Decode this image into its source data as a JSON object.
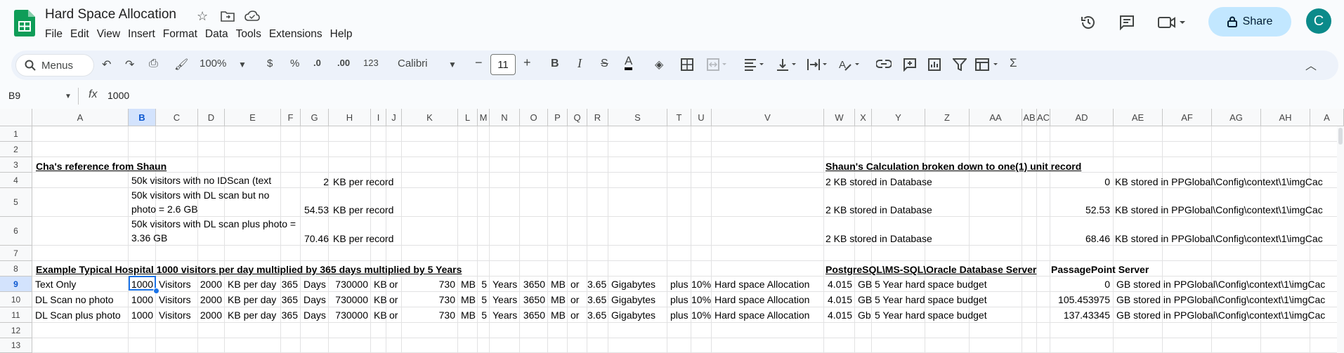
{
  "app": {
    "title": "Hard Space Allocation",
    "menu": [
      "File",
      "Edit",
      "View",
      "Insert",
      "Format",
      "Data",
      "Tools",
      "Extensions",
      "Help"
    ],
    "share_label": "Share",
    "avatar_letter": "C",
    "accent": "#0b57d0",
    "brand_green": "#0f9d58"
  },
  "toolbar": {
    "search_label": "Menus",
    "zoom": "100%",
    "currency": "$",
    "percent": "%",
    "dec_less": ".0",
    "dec_more": ".00",
    "number_format": "123",
    "font": "Calibri",
    "font_size": "11"
  },
  "formula_bar": {
    "name_box": "B9",
    "fx": "fx",
    "value": "1000"
  },
  "columns": [
    "A",
    "B",
    "C",
    "D",
    "E",
    "F",
    "G",
    "H",
    "I",
    "J",
    "K",
    "L",
    "M",
    "N",
    "O",
    "P",
    "Q",
    "R",
    "S",
    "T",
    "U",
    "V",
    "W",
    "X",
    "Y",
    "Z",
    "AA",
    "AB",
    "AC",
    "AD",
    "AE",
    "AF",
    "AG",
    "AH",
    "A"
  ],
  "rows": [
    "1",
    "2",
    "3",
    "4",
    "5",
    "6",
    "7",
    "8",
    "9",
    "10",
    "11",
    "12",
    "13"
  ],
  "cells": {
    "a3": "Cha's reference from Shaun",
    "w3": "Shaun's Calculation broken down to one(1) unit record",
    "b4": "50k visitors with no IDScan (text",
    "g4": "2",
    "h4": "KB per record",
    "w4": "2 KB stored in Database",
    "ad4": "0",
    "ae4": "KB stored in PPGlobal\\Config\\context\\1\\imgCac",
    "b5": "50k visitors with DL scan but no photo = 2.6 GB",
    "g5": "54.53",
    "h5": "KB per record",
    "w5": "2 KB stored in Database",
    "ad5": "52.53",
    "ae5": "KB stored in PPGlobal\\Config\\context\\1\\imgCac",
    "b6": "50k visitors with DL scan plus photo = 3.36 GB",
    "g6": "70.46",
    "h6": "KB per record",
    "w6": "2 KB stored in Database",
    "ad6": "68.46",
    "ae6": "KB stored in PPGlobal\\Config\\context\\1\\imgCac",
    "a8": "Example Typical Hospital 1000 visitors per day multiplied by 365 days multiplied by 5 Years",
    "w8": "PostgreSQL\\MS-SQL\\Oracle Database Server",
    "ad8": "PassagePoint Server"
  },
  "data_rows": [
    {
      "a": "Text Only",
      "b": "1000",
      "c": "Visitors",
      "d": "2000",
      "e": "KB per day",
      "f": "365",
      "g": "Days",
      "h": "730000",
      "i": "KB",
      "j": "or",
      "k": "730",
      "l": "MB",
      "m": "5",
      "n": "Years",
      "o": "3650",
      "p": "MB",
      "q": "or",
      "r": "3.65",
      "s": "Gigabytes",
      "t": "plus",
      "u": "10%",
      "v": "Hard space Allocation",
      "w": "4.015",
      "x": "GB",
      "y": "5 Year hard space budget",
      "ad": "0",
      "ae": "GB stored in PPGlobal\\Config\\context\\1\\imgCac"
    },
    {
      "a": "DL Scan no photo",
      "b": "1000",
      "c": "Visitors",
      "d": "2000",
      "e": "KB per day",
      "f": "365",
      "g": "Days",
      "h": "730000",
      "i": "KB",
      "j": "or",
      "k": "730",
      "l": "MB",
      "m": "5",
      "n": "Years",
      "o": "3650",
      "p": "MB",
      "q": "or",
      "r": "3.65",
      "s": "Gigabytes",
      "t": "plus",
      "u": "10%",
      "v": "Hard space Allocation",
      "w": "4.015",
      "x": "GB",
      "y": "5 Year hard space budget",
      "ad": "105.453975",
      "ae": "GB stored in PPGlobal\\Config\\context\\1\\imgCac"
    },
    {
      "a": "DL Scan plus photo",
      "b": "1000",
      "c": "Visitors",
      "d": "2000",
      "e": "KB per day",
      "f": "365",
      "g": "Days",
      "h": "730000",
      "i": "KB",
      "j": "or",
      "k": "730",
      "l": "MB",
      "m": "5",
      "n": "Years",
      "o": "3650",
      "p": "MB",
      "q": "or",
      "r": "3.65",
      "s": "Gigabytes",
      "t": "plus",
      "u": "10%",
      "v": "Hard space Allocation",
      "w": "4.015",
      "x": "Gb",
      "y": "5 Year hard space budget",
      "ad": "137.43345",
      "ae": "GB stored in PPGlobal\\Config\\context\\1\\imgCac"
    }
  ]
}
